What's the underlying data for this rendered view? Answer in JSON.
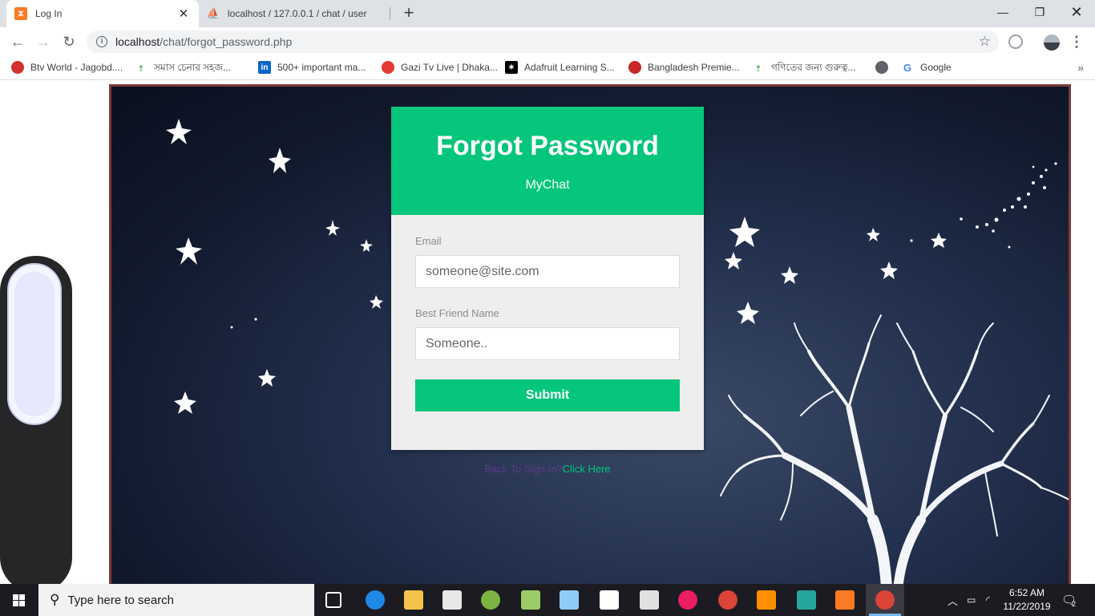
{
  "browser": {
    "tabs": [
      {
        "title": "Log In",
        "active": true,
        "icon": "xampp-icon"
      },
      {
        "title": "localhost / 127.0.0.1 / chat / user",
        "active": false,
        "icon": "phpmyadmin-icon"
      }
    ],
    "url_host": "localhost",
    "url_path": "/chat/forgot_password.php",
    "bookmarks": [
      {
        "label": "Btv World - Jagobd....",
        "icon": "btv-icon",
        "color": "#d32f2f"
      },
      {
        "label": "সমাস চেনার সহজ...",
        "icon": "pin-icon",
        "color": "#4caf50"
      },
      {
        "label": "500+ important ma...",
        "icon": "linkedin-icon",
        "color": "#0a66c2"
      },
      {
        "label": "Gazi Tv Live | Dhaka...",
        "icon": "gazi-icon",
        "color": "#e53935"
      },
      {
        "label": "Adafruit Learning S...",
        "icon": "adafruit-star-icon",
        "color": "#000000"
      },
      {
        "label": "Bangladesh Premie...",
        "icon": "cricket-ball-icon",
        "color": "#c62828"
      },
      {
        "label": "গণিতের জন্য গুরুত্ব...",
        "icon": "pin-icon",
        "color": "#4caf50"
      },
      {
        "label": "",
        "icon": "globe-icon",
        "color": "#5f6368"
      },
      {
        "label": "Google",
        "icon": "google-icon",
        "color": "#4285f4"
      }
    ]
  },
  "form": {
    "title": "Forgot Password",
    "subtitle": "MyChat",
    "email_label": "Email",
    "email_placeholder": "someone@site.com",
    "friend_label": "Best Friend Name",
    "friend_placeholder": "Someone..",
    "submit_label": "Submit",
    "back_text": "Back To Sign In?",
    "back_link": "Click Here"
  },
  "taskbar": {
    "search_placeholder": "Type here to search",
    "time": "6:52 AM",
    "date": "11/22/2019",
    "notification_count": "2"
  },
  "colors": {
    "accent": "#05c67b",
    "card_bg": "#eeeeee",
    "back_text": "#5b3a8a"
  }
}
